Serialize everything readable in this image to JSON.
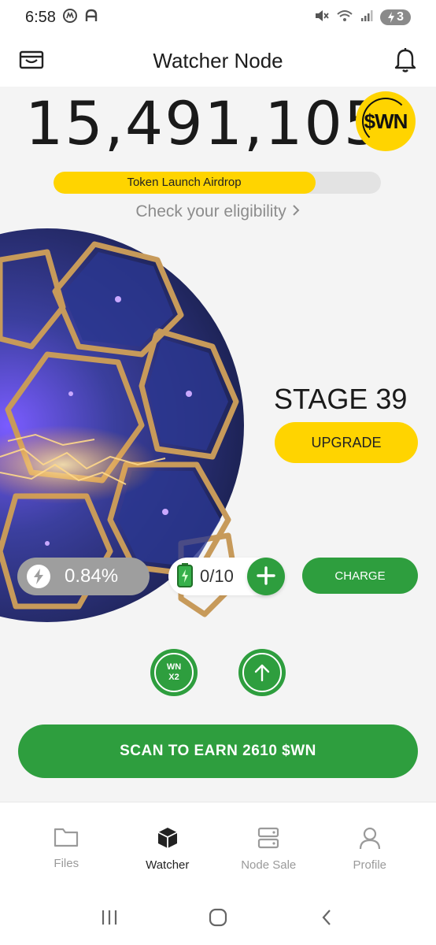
{
  "status_bar": {
    "time": "6:58",
    "battery": "3"
  },
  "header": {
    "title": "Watcher Node"
  },
  "balance": {
    "amount": "15,491,105",
    "token": "$WN"
  },
  "airdrop": {
    "label": "Token Launch Airdrop",
    "progress_percent": 80,
    "link": "Check your eligibility"
  },
  "stage": {
    "title": "STAGE 39",
    "upgrade_label": "UPGRADE"
  },
  "energy": {
    "value": "0.84%"
  },
  "batteries": {
    "count": "0/10"
  },
  "charge": {
    "label": "CHARGE"
  },
  "boost": {
    "line1": "WN",
    "line2": "X2"
  },
  "scan": {
    "label": "SCAN TO EARN 2610 $WN"
  },
  "nav": {
    "items": [
      {
        "label": "Files",
        "icon": "folder-icon"
      },
      {
        "label": "Watcher",
        "icon": "cube-icon",
        "active": true
      },
      {
        "label": "Node Sale",
        "icon": "server-icon"
      },
      {
        "label": "Profile",
        "icon": "person-icon"
      }
    ]
  },
  "colors": {
    "accent_yellow": "#ffd400",
    "accent_green": "#2e9e3e",
    "background": "#f4f4f4"
  }
}
